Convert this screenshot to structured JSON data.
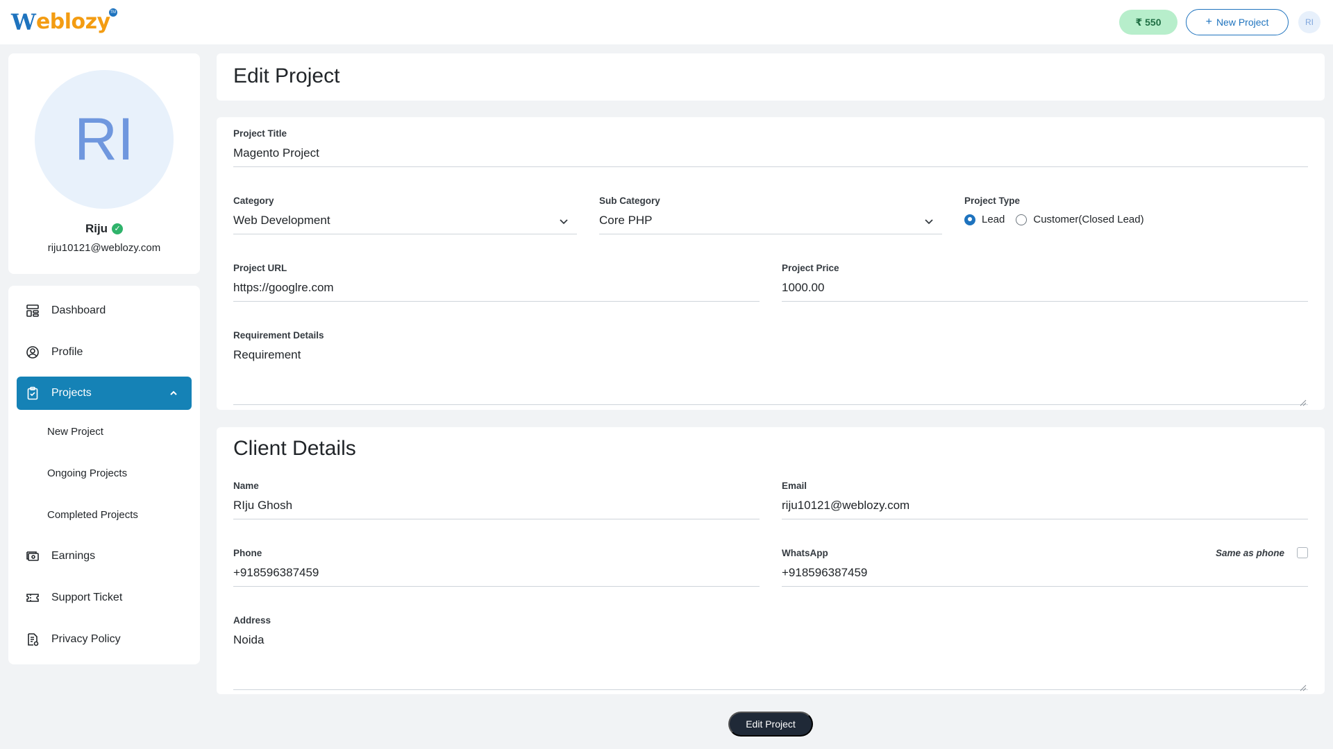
{
  "header": {
    "logo_mark": "W",
    "logo_text": "eblozy",
    "logo_tm": "TM",
    "balance": "₹ 550",
    "new_project_label": "New Project",
    "avatar_initials": "RI"
  },
  "profile": {
    "initials": "RI",
    "name": "Riju",
    "email": "riju10121@weblozy.com"
  },
  "sidebar": {
    "items": [
      {
        "label": "Dashboard",
        "icon": "dashboard-icon"
      },
      {
        "label": "Profile",
        "icon": "user-circle-icon"
      },
      {
        "label": "Projects",
        "icon": "clipboard-icon",
        "active": true
      },
      {
        "label": "Earnings",
        "icon": "cash-icon"
      },
      {
        "label": "Support Ticket",
        "icon": "ticket-icon"
      },
      {
        "label": "Privacy Policy",
        "icon": "policy-document-icon"
      }
    ],
    "sub_items": [
      "New Project",
      "Ongoing Projects",
      "Completed Projects"
    ]
  },
  "page": {
    "title": "Edit Project",
    "submit_label": "Edit Project"
  },
  "project": {
    "title_label": "Project Title",
    "title_value": "Magento Project",
    "category_label": "Category",
    "category_value": "Web Development",
    "subcategory_label": "Sub Category",
    "subcategory_value": "Core PHP",
    "type_label": "Project Type",
    "type_options": [
      "Lead",
      "Customer(Closed Lead)"
    ],
    "type_selected": "Lead",
    "url_label": "Project URL",
    "url_value": "https://googlre.com",
    "price_label": "Project Price",
    "price_value": "1000.00",
    "requirement_label": "Requirement Details",
    "requirement_value": "Requirement"
  },
  "client": {
    "section_title": "Client Details",
    "name_label": "Name",
    "name_value": "RIju Ghosh",
    "email_label": "Email",
    "email_value": "riju10121@weblozy.com",
    "phone_label": "Phone",
    "phone_value": "+918596387459",
    "whatsapp_label": "WhatsApp",
    "whatsapp_value": "+918596387459",
    "same_as_phone_label": "Same as phone",
    "same_as_phone_checked": false,
    "address_label": "Address",
    "address_value": "Noida"
  },
  "colors": {
    "accent": "#1582b6",
    "brand_blue": "#1e73be",
    "brand_orange": "#f39c12",
    "balance_bg": "#b7eecb",
    "submit_bg": "#1f2937"
  }
}
